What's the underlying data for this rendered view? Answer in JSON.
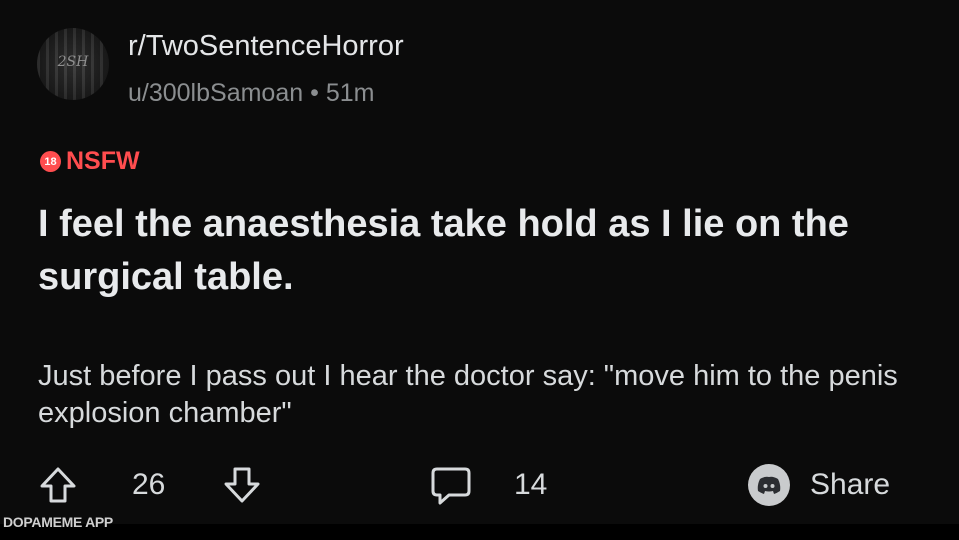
{
  "post": {
    "avatar_text": "2SH",
    "subreddit": "r/TwoSentenceHorror",
    "author": "u/300lbSamoan",
    "separator": "•",
    "age": "51m",
    "nsfw_icon_text": "18",
    "nsfw_label": "NSFW",
    "title": "I feel the anaesthesia take hold as I lie on the surgical table.",
    "body": "Just before I pass out I hear the doctor say: \"move him to the penis explosion chamber\""
  },
  "actions": {
    "upvote_icon": "arrow-up-icon",
    "upvotes": "26",
    "downvote_icon": "arrow-down-icon",
    "comment_icon": "speech-bubble-icon",
    "comments": "14",
    "share_icon": "discord-icon",
    "share_label": "Share"
  },
  "watermark": "DOPAMEME APP",
  "colors": {
    "background": "#0b0b0b",
    "nsfw": "#ff4d4f",
    "text": "#d7dadc",
    "muted": "#8b8e90"
  }
}
